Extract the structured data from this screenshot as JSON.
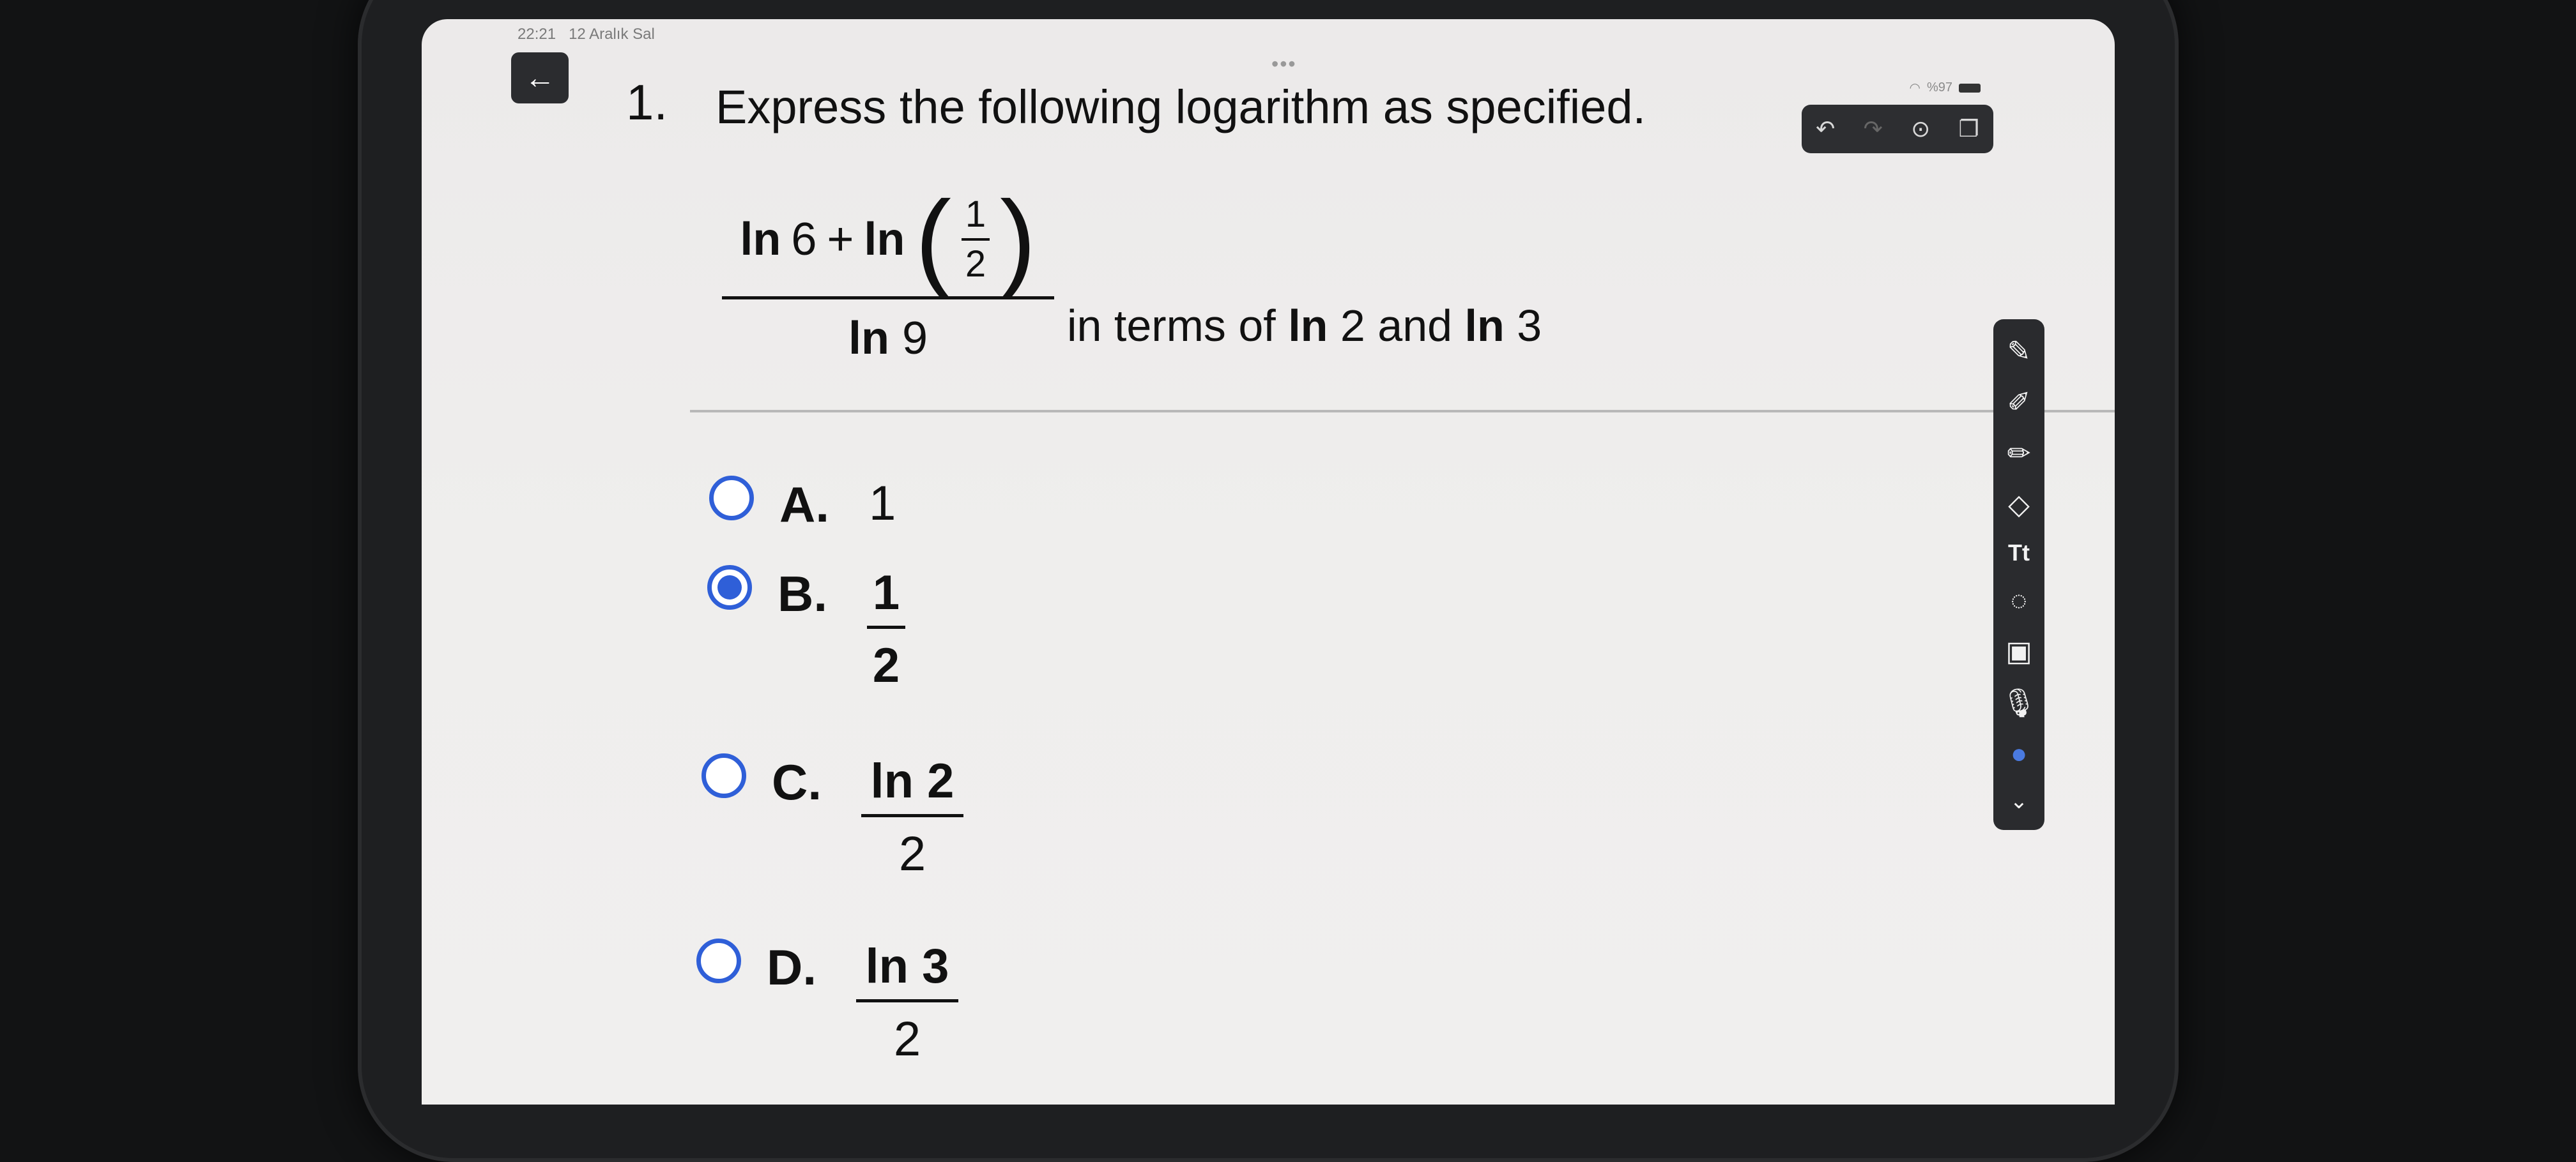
{
  "status": {
    "time": "22:21",
    "date": "12 Aralık Sal",
    "battery": "%97"
  },
  "question": {
    "number": "1.",
    "text": "Express the following logarithm as specified.",
    "fraction": {
      "num_ln1": "ln",
      "num_a": "6",
      "plus": "+",
      "num_ln2": "ln",
      "inner_num": "1",
      "inner_den": "2",
      "den_ln": "ln",
      "den_val": "9"
    },
    "in_terms_prefix": "in terms of",
    "ln_a": "ln",
    "val_a": "2",
    "and": "and",
    "ln_b": "ln",
    "val_b": "3"
  },
  "options": [
    {
      "letter": "A.",
      "value": "1",
      "selected": false
    },
    {
      "letter": "B.",
      "num": "1",
      "den": "2",
      "selected": true
    },
    {
      "letter": "C.",
      "num": "ln 2",
      "den": "2",
      "selected": false
    },
    {
      "letter": "D.",
      "num": "ln 3",
      "den": "2",
      "selected": false
    }
  ],
  "icons": {
    "back": "arrow-left-icon",
    "undo": "undo-icon",
    "redo": "redo-icon",
    "more": "more-icon",
    "copy": "copy-icon"
  },
  "colors": {
    "accent": "#2f5fd8",
    "toolbar": "#2a2b2e"
  }
}
